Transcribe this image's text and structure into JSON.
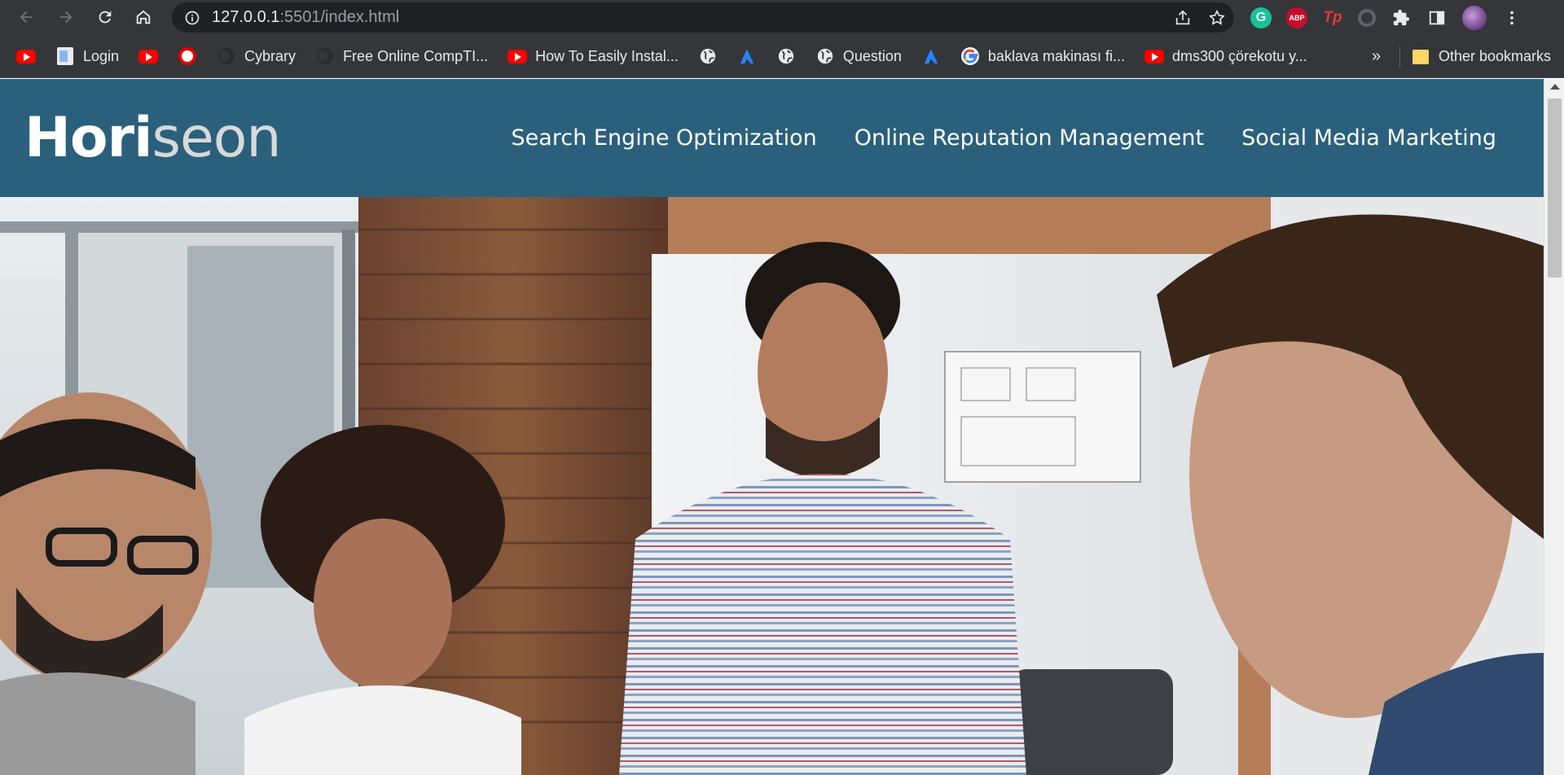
{
  "browser": {
    "url_host": "127.0.0.1",
    "url_rest": ":5501/index.html",
    "bookmarks": [
      {
        "icon": "youtube-icon",
        "label": ""
      },
      {
        "icon": "document-icon",
        "label": "Login"
      },
      {
        "icon": "youtube-icon",
        "label": ""
      },
      {
        "icon": "vodafone-icon",
        "label": ""
      },
      {
        "icon": "cybrary-icon",
        "label": "Cybrary"
      },
      {
        "icon": "cybrary-icon",
        "label": "Free Online CompTI..."
      },
      {
        "icon": "youtube-icon",
        "label": "How To Easily Instal..."
      },
      {
        "icon": "globe-icon",
        "label": ""
      },
      {
        "icon": "atlassian-icon",
        "label": ""
      },
      {
        "icon": "globe-icon",
        "label": ""
      },
      {
        "icon": "globe-icon",
        "label": "Question"
      },
      {
        "icon": "atlassian-icon",
        "label": ""
      },
      {
        "icon": "google-icon",
        "label": "baklava makinası fi..."
      },
      {
        "icon": "youtube-icon",
        "label": "dms300 çörekotu y..."
      }
    ],
    "more_label": "»",
    "other_bookmarks": "Other bookmarks",
    "ext_abp": "ABP",
    "ext_tp": "Tp",
    "ext_g": "G"
  },
  "site": {
    "brand_main": "Hori",
    "brand_accent": "seon",
    "nav": [
      "Search Engine Optimization",
      "Online Reputation Management",
      "Social Media Marketing"
    ]
  },
  "colors": {
    "header_bg": "#2a607c",
    "chrome_bg": "#35363a"
  }
}
